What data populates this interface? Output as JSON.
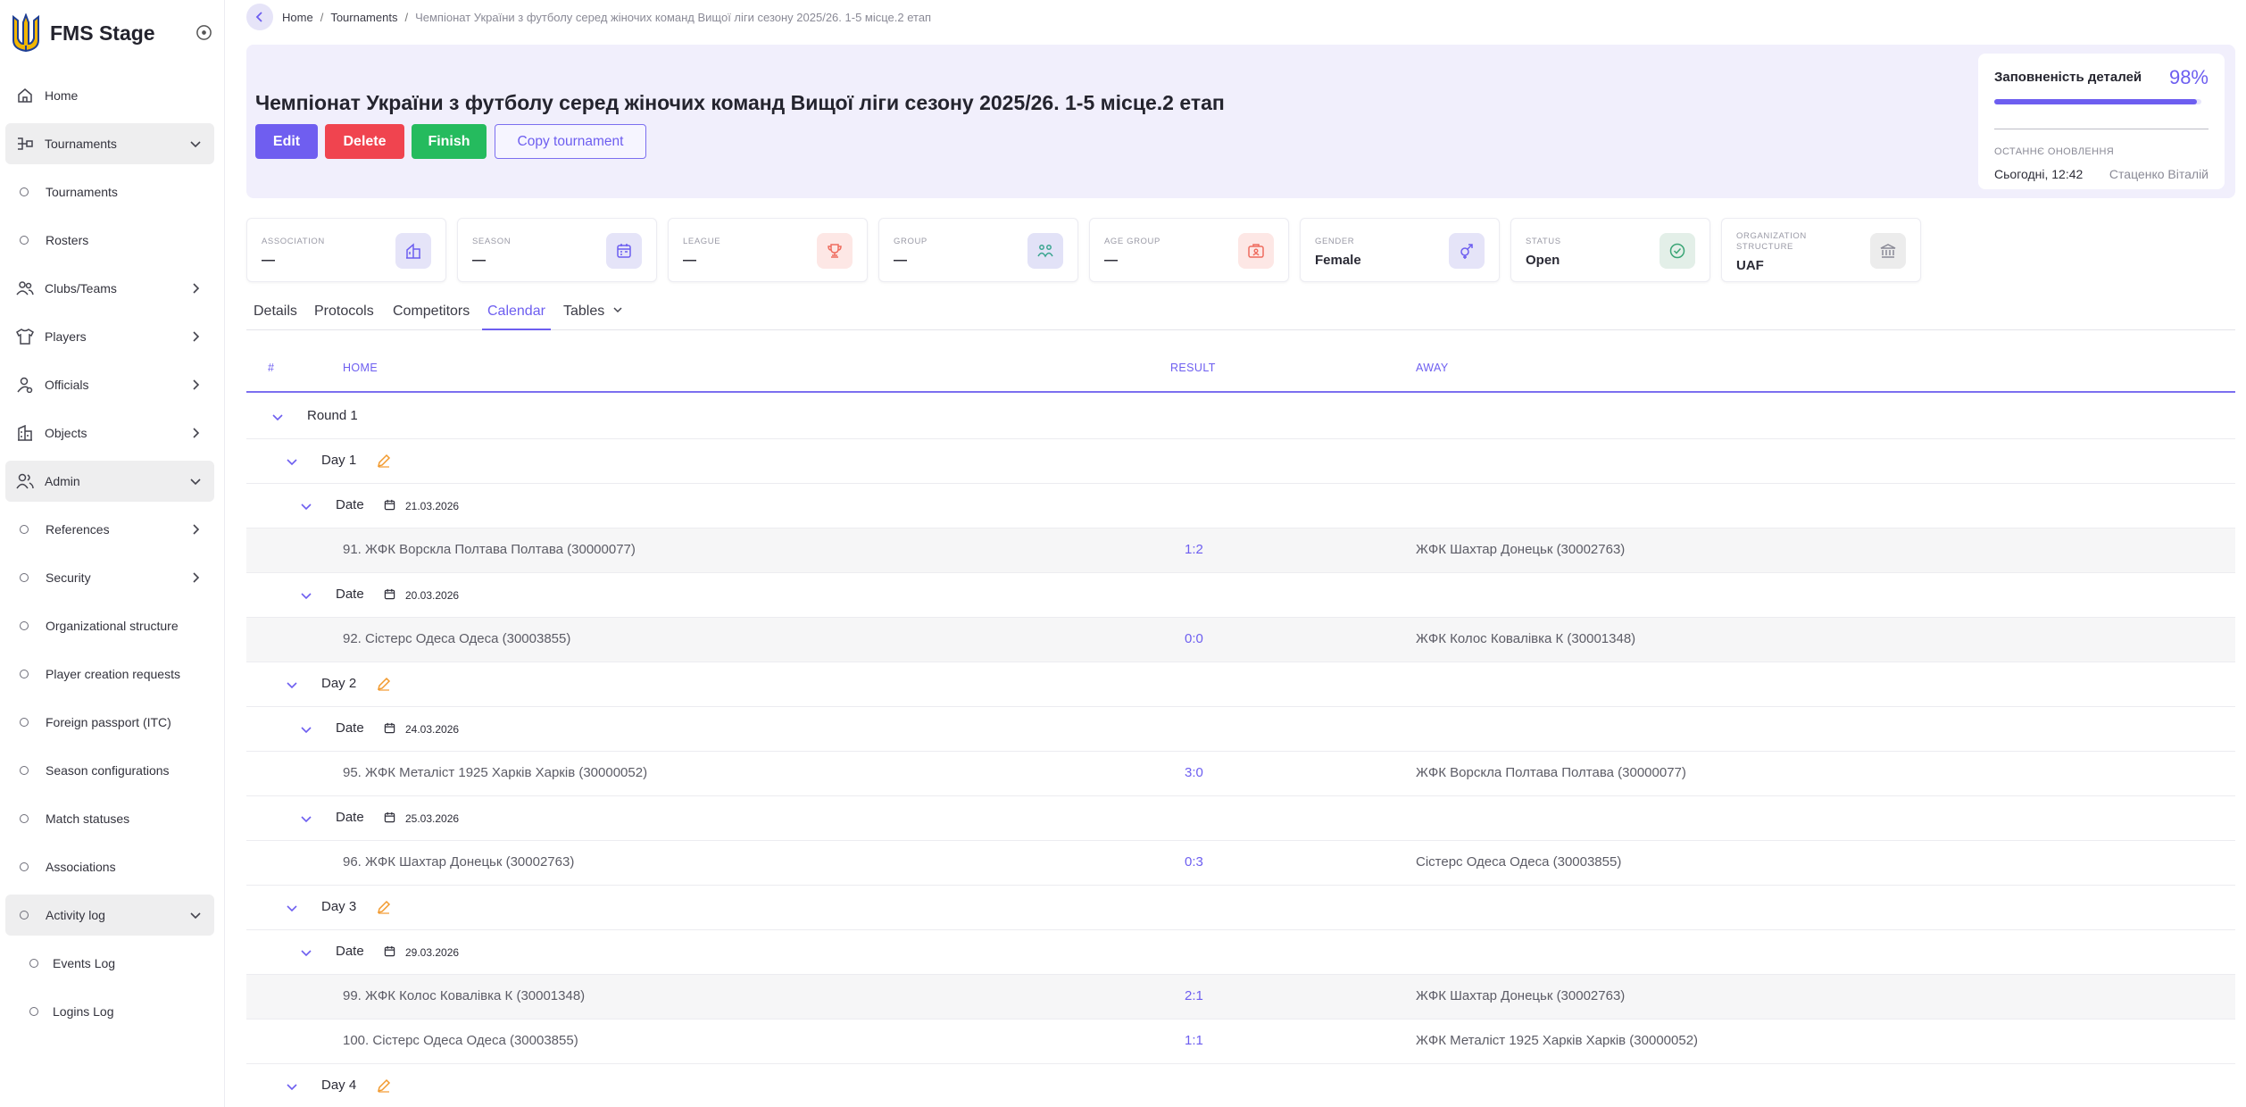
{
  "app": {
    "title": "FMS Stage"
  },
  "sidebar": {
    "items": [
      {
        "label": "Home"
      },
      {
        "label": "Tournaments"
      },
      {
        "label": "Tournaments"
      },
      {
        "label": "Rosters"
      },
      {
        "label": "Clubs/Teams"
      },
      {
        "label": "Players"
      },
      {
        "label": "Officials"
      },
      {
        "label": "Objects"
      },
      {
        "label": "Admin"
      },
      {
        "label": "References"
      },
      {
        "label": "Security"
      },
      {
        "label": "Organizational structure"
      },
      {
        "label": "Player creation requests"
      },
      {
        "label": "Foreign passport (ITC)"
      },
      {
        "label": "Season configurations"
      },
      {
        "label": "Match statuses"
      },
      {
        "label": "Associations"
      },
      {
        "label": "Activity log"
      },
      {
        "label": "Events Log"
      },
      {
        "label": "Logins Log"
      }
    ]
  },
  "breadcrumb": {
    "home": "Home",
    "tournaments": "Tournaments",
    "separator": "/",
    "current": "Чемпіонат України з футболу серед жіночих команд Вищої ліги сезону 2025/26. 1-5 місце.2 етап"
  },
  "header": {
    "title": "Чемпіонат України з футболу серед жіночих команд Вищої ліги сезону 2025/26. 1-5 місце.2 етап",
    "buttons": {
      "edit": "Edit",
      "delete": "Delete",
      "finish": "Finish",
      "copy": "Copy tournament"
    },
    "completeness": {
      "label": "Заповненість деталей",
      "percent_text": "98%",
      "value": 0.98,
      "updated_label": "ОСТАННЄ ОНОВЛЕННЯ",
      "updated_date": "Сьогодні, 12:42",
      "updated_by": "Стаценко Віталій"
    }
  },
  "cards": [
    {
      "key": "ASSOCIATION",
      "value": "—",
      "icon": "building-icon"
    },
    {
      "key": "SEASON",
      "value": "—",
      "icon": "calendar-icon"
    },
    {
      "key": "LEAGUE",
      "value": "—",
      "icon": "trophy-icon"
    },
    {
      "key": "GROUP",
      "value": "—",
      "icon": "group-icon"
    },
    {
      "key": "AGE GROUP",
      "value": "—",
      "icon": "id-card-icon"
    },
    {
      "key": "GENDER",
      "value": "Female",
      "icon": "gender-icon"
    },
    {
      "key": "STATUS",
      "value": "Open",
      "icon": "check-circle-icon"
    },
    {
      "key": "ORGANIZATION STRUCTURE",
      "value": "UAF",
      "icon": "institution-icon"
    }
  ],
  "colors": {
    "accent": "#6d5ef0",
    "delete": "#f0444f",
    "finish": "#25bb5e",
    "card_icon_bgs": [
      "#e5e4f8",
      "#e5e4f8",
      "#fde7e5",
      "#e2e2f7",
      "#fde7e5",
      "#e5e4f8",
      "#e3efe8",
      "#ececec"
    ],
    "card_icon_colors": [
      "#6d5ef0",
      "#6d5ef0",
      "#ef6c5e",
      "#3aa590",
      "#ef6c5e",
      "#6d5ef0",
      "#3aa575",
      "#8a8a96"
    ]
  },
  "tabs": [
    {
      "label": "Details"
    },
    {
      "label": "Protocols"
    },
    {
      "label": "Competitors"
    },
    {
      "label": "Calendar",
      "active": true
    },
    {
      "label": "Tables"
    }
  ],
  "table": {
    "columns": {
      "num": "#",
      "home": "HOME",
      "result": "RESULT",
      "away": "AWAY"
    },
    "rows": [
      {
        "type": "round",
        "label": "Round  1"
      },
      {
        "type": "day",
        "label": "Day  1"
      },
      {
        "type": "date",
        "label": "Date",
        "date": "21.03.2026"
      },
      {
        "type": "match",
        "home": "91. ЖФК Ворскла Полтава Полтава (30000077)",
        "result": "1:2",
        "away": "ЖФК Шахтар Донецьк (30002763)"
      },
      {
        "type": "date",
        "label": "Date",
        "date": "20.03.2026"
      },
      {
        "type": "match",
        "home": "92. Сістерс Одеса Одеса (30003855)",
        "result": "0:0",
        "away": "ЖФК Колос Ковалівка К (30001348)"
      },
      {
        "type": "day",
        "label": "Day  2"
      },
      {
        "type": "date",
        "label": "Date",
        "date": "24.03.2026"
      },
      {
        "type": "match",
        "home": "95. ЖФК Металіст 1925 Харків Харків (30000052)",
        "result": "3:0",
        "away": "ЖФК Ворскла Полтава Полтава (30000077)",
        "white": true
      },
      {
        "type": "date",
        "label": "Date",
        "date": "25.03.2026"
      },
      {
        "type": "match",
        "home": "96. ЖФК Шахтар Донецьк (30002763)",
        "result": "0:3",
        "away": "Сістерс Одеса Одеса (30003855)",
        "white": true
      },
      {
        "type": "day",
        "label": "Day  3"
      },
      {
        "type": "date",
        "label": "Date",
        "date": "29.03.2026"
      },
      {
        "type": "match",
        "home": "99. ЖФК Колос Ковалівка К (30001348)",
        "result": "2:1",
        "away": "ЖФК Шахтар Донецьк (30002763)"
      },
      {
        "type": "match",
        "home": "100. Сістерс Одеса Одеса (30003855)",
        "result": "1:1",
        "away": "ЖФК Металіст 1925 Харків Харків (30000052)",
        "white": true
      },
      {
        "type": "day",
        "label": "Day  4"
      }
    ]
  }
}
